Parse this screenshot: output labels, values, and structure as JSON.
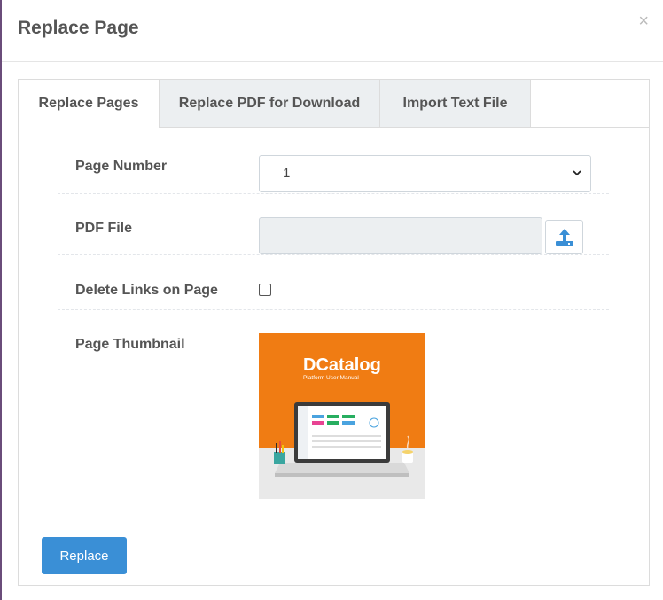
{
  "modal": {
    "title": "Replace Page",
    "close_symbol": "×"
  },
  "tabs": [
    {
      "label": "Replace Pages",
      "active": true
    },
    {
      "label": "Replace PDF for Download",
      "active": false
    },
    {
      "label": "Import Text File",
      "active": false
    }
  ],
  "form": {
    "page_number": {
      "label": "Page Number",
      "selected": "1"
    },
    "pdf_file": {
      "label": "PDF File",
      "value": "",
      "upload_icon": "upload-icon"
    },
    "delete_links": {
      "label": "Delete Links on Page",
      "checked": false
    },
    "thumbnail": {
      "label": "Page Thumbnail",
      "logo_text": "DCatalog",
      "logo_subtitle": "Platform User Manual"
    }
  },
  "actions": {
    "replace_label": "Replace"
  },
  "colors": {
    "accent": "#3a8fd6",
    "thumbnail_orange": "#f07c13"
  }
}
